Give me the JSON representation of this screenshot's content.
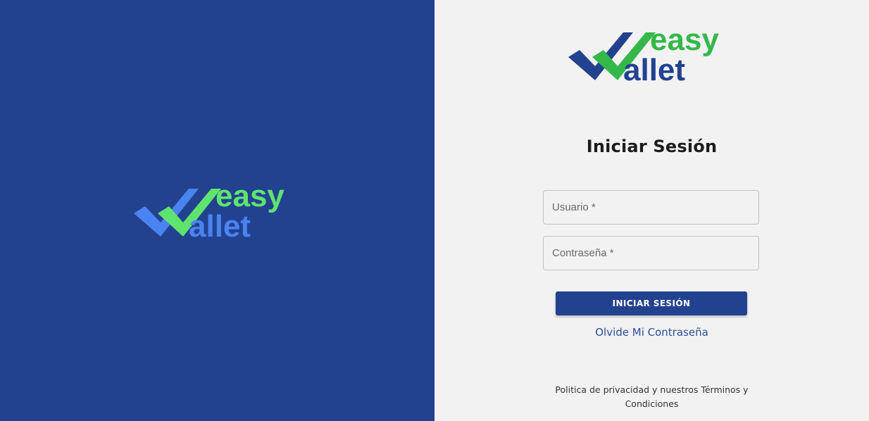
{
  "brand": {
    "name_line1": "easy",
    "name_line2": "allet",
    "colors": {
      "navy": "#224290",
      "green_dark_bg": "#4fd16a",
      "green_light_bg": "#35b84a",
      "blue_light": "#4b83f0",
      "text_light_bg": "#224290"
    }
  },
  "login": {
    "title": "Iniciar Sesión",
    "username_placeholder": "Usuario *",
    "password_placeholder": "Contraseña *",
    "submit_label": "INICIAR SESIÓN",
    "forgot_password_label": "Olvide Mi Contraseña"
  },
  "footer": {
    "privacy_terms_text": "Politica de privacidad y nuestros Términos y Condiciones"
  },
  "icons": {
    "logo_check_icon": "double-checkmark-logo-icon"
  }
}
